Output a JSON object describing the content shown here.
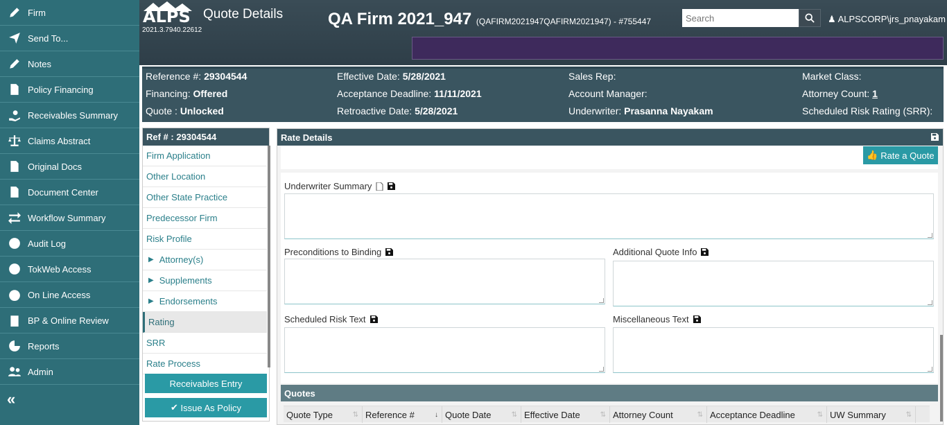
{
  "nav": {
    "items": [
      {
        "label": "Firm",
        "icon": "pencil-icon"
      },
      {
        "label": "Send To...",
        "icon": "paper-plane-icon"
      },
      {
        "label": "Notes",
        "icon": "pencil-icon"
      },
      {
        "label": "Policy Financing",
        "icon": "document-dollar-icon"
      },
      {
        "label": "Receivables Summary",
        "icon": "hand-coin-icon"
      },
      {
        "label": "Claims Abstract",
        "icon": "scales-icon"
      },
      {
        "label": "Original Docs",
        "icon": "file-icon"
      },
      {
        "label": "Document Center",
        "icon": "file-text-icon"
      },
      {
        "label": "Workflow Summary",
        "icon": "arrows-swap-icon"
      },
      {
        "label": "Audit Log",
        "icon": "history-icon"
      },
      {
        "label": "TokWeb Access",
        "icon": "globe-icon"
      },
      {
        "label": "On Line Access",
        "icon": "lock-icon"
      },
      {
        "label": "BP & Online Review",
        "icon": "clipboard-dollar-icon"
      },
      {
        "label": "Reports",
        "icon": "pie-chart-icon"
      },
      {
        "label": "Admin",
        "icon": "users-cog-icon"
      }
    ],
    "collapse": "«"
  },
  "header": {
    "logo": "ALPS",
    "version": "2021.3.7940.22612",
    "page_title": "Quote Details",
    "firm_name": "QA Firm 2021_947",
    "firm_sub": "(QAFIRM2021947QAFIRM2021947) - #755447",
    "search_placeholder": "Search",
    "user": "ALPSCORP\\jrs_pnayakam"
  },
  "info": {
    "reference_label": "Reference #:",
    "reference_value": "29304544",
    "financing_label": "Financing:",
    "financing_value": "Offered",
    "quote_label": "Quote :",
    "quote_value": "Unlocked",
    "effective_label": "Effective Date:",
    "effective_value": "5/28/2021",
    "acceptance_label": "Acceptance Deadline:",
    "acceptance_value": "11/11/2021",
    "retro_label": "Retroactive Date:",
    "retro_value": "5/28/2021",
    "salesrep_label": "Sales Rep:",
    "account_label": "Account Manager:",
    "underwriter_label": "Underwriter:",
    "underwriter_value": "Prasanna Nayakam",
    "market_label": "Market Class:",
    "attorney_label": "Attorney Count:",
    "attorney_value": "1",
    "srr_label": "Scheduled Risk Rating (SRR):"
  },
  "submenu": {
    "title": "Ref # : 29304544",
    "items": [
      {
        "label": "Firm Application"
      },
      {
        "label": "Other Location"
      },
      {
        "label": "Other State Practice"
      },
      {
        "label": "Predecessor Firm"
      },
      {
        "label": "Risk Profile"
      },
      {
        "label": "Attorney(s)"
      },
      {
        "label": "Supplements"
      },
      {
        "label": "Endorsements"
      },
      {
        "label": "Rating"
      },
      {
        "label": "SRR"
      },
      {
        "label": "Rate Process"
      }
    ],
    "receivables_btn": "Receivables Entry",
    "issue_btn": "Issue As Policy"
  },
  "rate": {
    "title": "Rate Details",
    "rate_btn": "Rate a Quote",
    "uw_summary": "Underwriter Summary",
    "preconditions": "Preconditions to Binding",
    "additional": "Additional Quote Info",
    "scheduled_risk": "Scheduled Risk Text",
    "misc": "Miscellaneous Text"
  },
  "quotes": {
    "title": "Quotes",
    "columns": [
      "Quote Type",
      "Reference #",
      "Quote Date",
      "Effective Date",
      "Attorney Count",
      "Acceptance Deadline",
      "UW Summary"
    ]
  }
}
